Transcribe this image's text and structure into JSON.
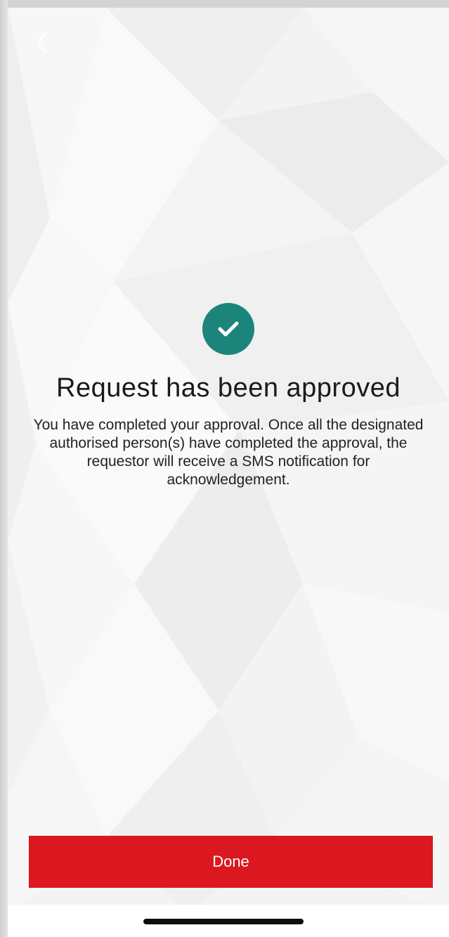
{
  "nav": {
    "back_icon": "chevron-left-icon"
  },
  "status": {
    "icon": "check-circle-icon",
    "color": "#1c857b"
  },
  "main": {
    "title": "Request has been approved",
    "message": "You have completed your approval. Once all the designated authorised person(s) have completed the approval, the requestor will receive a SMS notification for acknowledgement."
  },
  "actions": {
    "done_label": "Done",
    "done_color": "#db1720"
  }
}
